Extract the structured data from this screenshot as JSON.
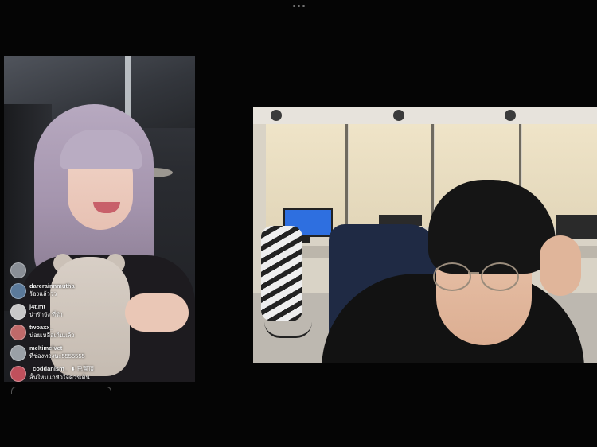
{
  "comments": [
    {
      "user": "",
      "message": "",
      "avatar_color": "#8a8f96"
    },
    {
      "user": "darerainnmutha",
      "message": "ร้องแล้ววว",
      "avatar_color": "#5b7a9a"
    },
    {
      "user": "j4t.mt",
      "message": "น่ารักจัง ที่รัก",
      "avatar_color": "#c8c8c8"
    },
    {
      "user": "twoaxx_",
      "message": "น่อยเหลือเกินแล้ว",
      "avatar_color": "#c06a6a"
    },
    {
      "user": "meltimelvet",
      "message": "ที่ช่องทองนะ5555555",
      "avatar_color": "#9aa0a6"
    },
    {
      "user": "_coddanism_",
      "message": "ลิ้นใหม่แก่หัวใจควรเดิน",
      "follow": "⬇ 已置頂",
      "avatar_color": "#c0505c"
    }
  ]
}
